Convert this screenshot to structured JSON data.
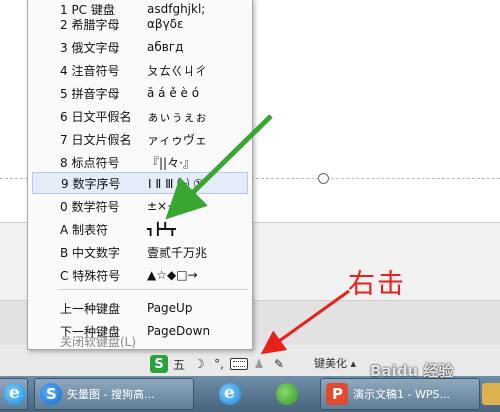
{
  "soft_keyboard_menu": {
    "items": [
      {
        "label": "1 PC 键盘",
        "sample": "asdfghjkl;"
      },
      {
        "label": "2 希腊字母",
        "sample": "αβγδε"
      },
      {
        "label": "3 俄文字母",
        "sample": "абвгд"
      },
      {
        "label": "4 注音符号",
        "sample": "ㄆㄊㄍㄐㄔ"
      },
      {
        "label": "5 拼音字母",
        "sample": "ā á ě è ó"
      },
      {
        "label": "6 日文平假名",
        "sample": "ぁぃぅぇぉ"
      },
      {
        "label": "7 日文片假名",
        "sample": "ァィゥヴェ"
      },
      {
        "label": "8 标点符号",
        "sample": "『||々·』"
      },
      {
        "label": "9 数字序号",
        "sample": "Ⅰ Ⅱ Ⅲ ㈠ ①",
        "highlighted": true
      },
      {
        "label": "0 数学符号",
        "sample": "±×÷∑√"
      },
      {
        "label": "A 制表符",
        "sample": "┓┣┻┳"
      },
      {
        "label": "B 中文数字",
        "sample": "壹贰千万兆"
      },
      {
        "label": "C 特殊符号",
        "sample": "▲☆◆□→"
      }
    ],
    "nav_items": [
      {
        "label": "上一种键盘",
        "sample": "PageUp"
      },
      {
        "label": "下一种键盘",
        "sample": "PageDown"
      }
    ],
    "close_label": "关闭软键盘(L)"
  },
  "ime_toolbar": {
    "logo": "S",
    "full_half": "五",
    "moon": "☽",
    "punct": "°,",
    "person": "♟",
    "wrench": "✎",
    "beautify_label": "键美化 ▴"
  },
  "annotation": {
    "text": "右击",
    "arrow_color": "#e8211b",
    "green_arrow_color": "#3aa632"
  },
  "taskbar": {
    "items": [
      {
        "label": "矢量图 - 搜狗高...",
        "icon": "sogou-browser-icon"
      },
      {
        "label": "演示文稿1 - WPS...",
        "icon": "wps-presentation-icon"
      }
    ]
  },
  "watermark": "Baidu 经验"
}
